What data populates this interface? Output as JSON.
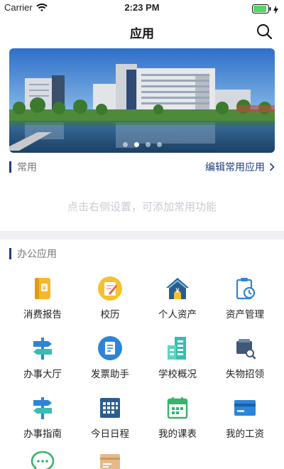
{
  "status_bar": {
    "carrier": "Carrier",
    "time": "2:23 PM",
    "battery_level": 0.9
  },
  "header": {
    "title": "应用",
    "search_icon": "search-icon"
  },
  "banner": {
    "slide_count": 4,
    "active_index": 1
  },
  "common": {
    "label": "常用",
    "edit_link": "编辑常用应用",
    "empty_hint": "点击右侧设置，可添加常用功能"
  },
  "office": {
    "label": "办公应用",
    "apps": [
      {
        "label": "消费报告",
        "icon": "report-book-icon"
      },
      {
        "label": "校历",
        "icon": "calendar-note-icon"
      },
      {
        "label": "个人资产",
        "icon": "house-asset-icon"
      },
      {
        "label": "资产管理",
        "icon": "clipboard-clock-icon"
      },
      {
        "label": "办事大厅",
        "icon": "signpost-icon"
      },
      {
        "label": "发票助手",
        "icon": "invoice-icon"
      },
      {
        "label": "学校概况",
        "icon": "building-icon"
      },
      {
        "label": "失物招领",
        "icon": "wallet-search-icon"
      },
      {
        "label": "办事指南",
        "icon": "guide-signpost-icon"
      },
      {
        "label": "今日日程",
        "icon": "schedule-grid-icon"
      },
      {
        "label": "我的课表",
        "icon": "timetable-icon"
      },
      {
        "label": "我的工资",
        "icon": "salary-card-icon"
      },
      {
        "label": "",
        "icon": "chat-bubble-icon"
      },
      {
        "label": "",
        "icon": "ticket-icon"
      }
    ]
  },
  "colors": {
    "accent": "#1f3e7c",
    "hint": "#c8cbd2",
    "battery": "#4cd964",
    "icon_blue": "#2d84d8",
    "icon_teal": "#3bbcb0",
    "icon_yellow": "#f5c12e",
    "icon_green": "#38b36b"
  }
}
